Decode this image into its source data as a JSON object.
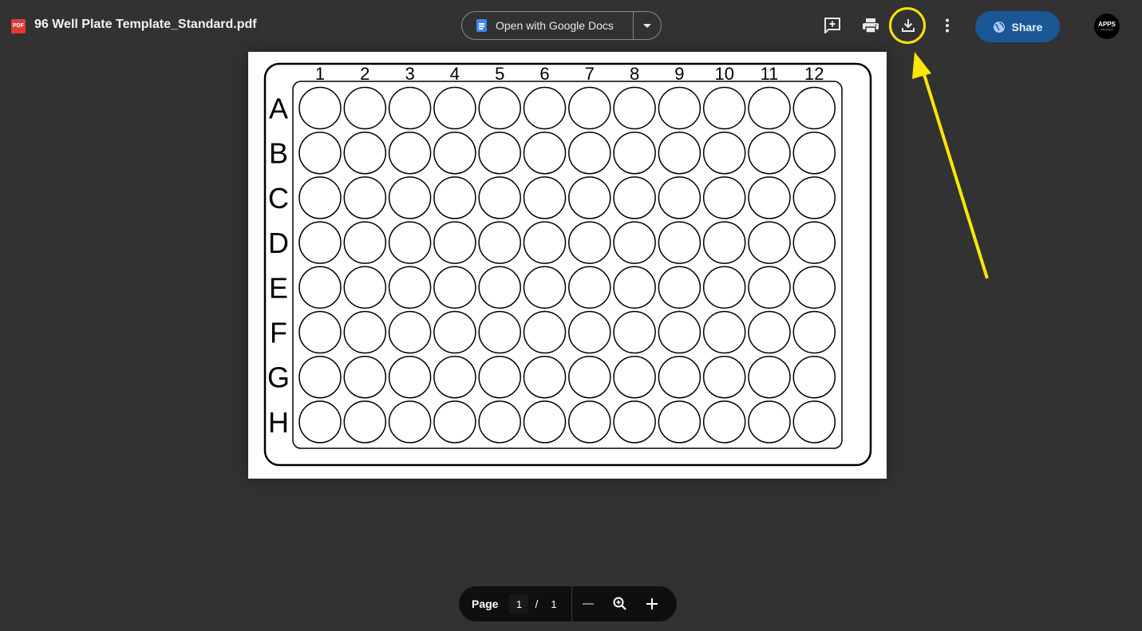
{
  "header": {
    "file_icon_label": "PDF",
    "file_name": "96 Well Plate Template_Standard.pdf",
    "open_with_label": "Open with Google Docs",
    "share_label": "Share",
    "avatar_text": "APPS",
    "avatar_subtext": "that deliver",
    "toolbar_icons": [
      "add-comment-icon",
      "print-icon",
      "download-icon",
      "more-vert-icon"
    ],
    "highlight_color": "#ffe600"
  },
  "document": {
    "columns": [
      "1",
      "2",
      "3",
      "4",
      "5",
      "6",
      "7",
      "8",
      "9",
      "10",
      "11",
      "12"
    ],
    "rows": [
      "A",
      "B",
      "C",
      "D",
      "E",
      "F",
      "G",
      "H"
    ]
  },
  "page_controls": {
    "page_label": "Page",
    "current_page": "1",
    "separator": "/",
    "total_pages": "1"
  },
  "colors": {
    "background": "#323232",
    "share_button": "#1a5794",
    "annotation": "#ffe600"
  }
}
